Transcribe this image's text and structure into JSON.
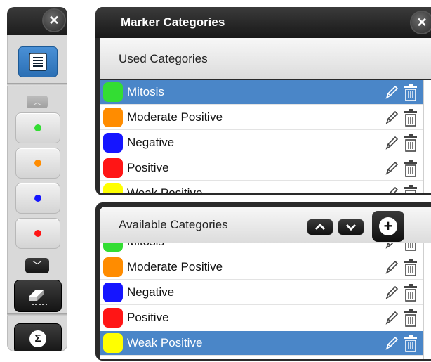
{
  "toolbar": {
    "close_glyph": "✕",
    "up_glyph": "︿",
    "down_glyph": "﹀",
    "sigma_glyph": "Σ",
    "swatches": [
      {
        "color": "#33dd33"
      },
      {
        "color": "#ff8c00"
      },
      {
        "color": "#1515ff"
      },
      {
        "color": "#ff1515"
      }
    ]
  },
  "used_panel": {
    "title": "Marker Categories",
    "close_glyph": "✕",
    "header": "Used Categories",
    "rows": [
      {
        "label": "Mitosis",
        "color": "#33dd33",
        "selected": true
      },
      {
        "label": "Moderate Positive",
        "color": "#ff8c00",
        "selected": false
      },
      {
        "label": "Negative",
        "color": "#1515ff",
        "selected": false
      },
      {
        "label": "Positive",
        "color": "#ff1515",
        "selected": false
      },
      {
        "label": "Weak Positive",
        "color": "#ffff00",
        "selected": false
      }
    ]
  },
  "available_panel": {
    "header": "Available Categories",
    "add_glyph": "+",
    "rows": [
      {
        "label": "Mitosis",
        "color": "#33dd33",
        "selected": false
      },
      {
        "label": "Moderate Positive",
        "color": "#ff8c00",
        "selected": false
      },
      {
        "label": "Negative",
        "color": "#1515ff",
        "selected": false
      },
      {
        "label": "Positive",
        "color": "#ff1515",
        "selected": false
      },
      {
        "label": "Weak Positive",
        "color": "#ffff00",
        "selected": true
      }
    ]
  },
  "colors": {
    "selection": "#4a86c8",
    "panel_dark": "#2a2a2a"
  }
}
